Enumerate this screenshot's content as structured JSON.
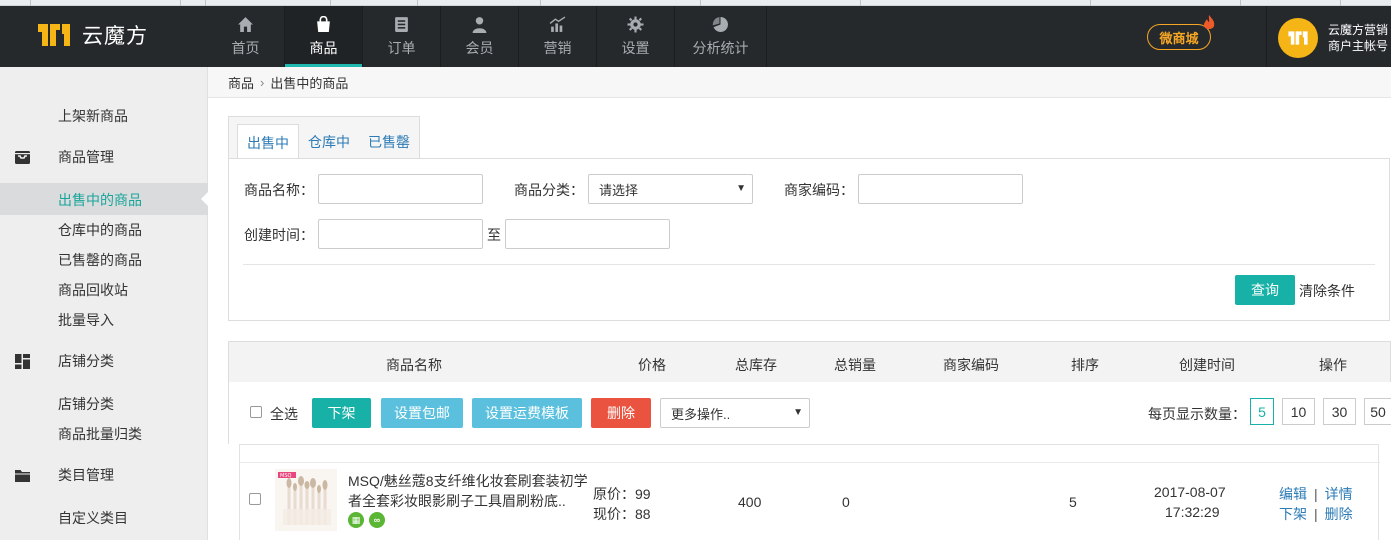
{
  "brand": {
    "name": "云魔方",
    "accent": "#1fb9b0",
    "logo_color": "#f6b516"
  },
  "nav": [
    {
      "label": "首页",
      "icon": "home-icon"
    },
    {
      "label": "商品",
      "icon": "shopping-bag-icon",
      "active": true
    },
    {
      "label": "订单",
      "icon": "order-list-icon"
    },
    {
      "label": "会员",
      "icon": "user-icon"
    },
    {
      "label": "营销",
      "icon": "marketing-chart-icon"
    },
    {
      "label": "设置",
      "icon": "gear-icon"
    },
    {
      "label": "分析统计",
      "icon": "pie-chart-icon"
    }
  ],
  "header": {
    "mall_badge": "微商城",
    "user_name": "云魔方营销",
    "user_role": "商户主帐号"
  },
  "sidebar": {
    "top_link": "上架新商品",
    "groups": [
      {
        "title": "商品管理",
        "icon": "inbox-icon",
        "items": [
          "出售中的商品",
          "仓库中的商品",
          "已售罄的商品",
          "商品回收站",
          "批量导入"
        ]
      },
      {
        "title": "店铺分类",
        "icon": "grid-icon",
        "items": [
          "店铺分类",
          "商品批量归类"
        ]
      },
      {
        "title": "类目管理",
        "icon": "folder-icon",
        "items": [
          "自定义类目"
        ]
      }
    ],
    "active_item": "出售中的商品"
  },
  "breadcrumb": {
    "root": "商品",
    "current": "出售中的商品"
  },
  "tabs": [
    "出售中",
    "仓库中",
    "已售罄"
  ],
  "filter": {
    "name_label": "商品名称：",
    "category_label": "商品分类：",
    "category_value": "请选择",
    "code_label": "商家编码：",
    "created_label": "创建时间：",
    "to_label": "至",
    "query_button": "查询",
    "clear_link": "清除条件"
  },
  "table": {
    "columns": [
      "商品名称",
      "价格",
      "总库存",
      "总销量",
      "商家编码",
      "排序",
      "创建时间",
      "操作"
    ]
  },
  "toolbar": {
    "select_all": "全选",
    "btn_off_shelf": "下架",
    "btn_free_shipping": "设置包邮",
    "btn_freight": "设置运费模板",
    "btn_delete": "删除",
    "more_ops": "更多操作..",
    "page_size_label": "每页显示数量：",
    "page_sizes": [
      "5",
      "10",
      "30",
      "50"
    ],
    "page_size_active": "5"
  },
  "rows": [
    {
      "thumb_brand": "MSQ",
      "title": "MSQ/魅丝蔻8支纤维化妆套刷套装初学者全套彩妆眼影刷子工具眉刷粉底..",
      "badge_icons": [
        "qr-code-icon",
        "link-icon"
      ],
      "original_price": "原价：99",
      "current_price": "现价：88",
      "stock": "400",
      "sales": "0",
      "merchant_code": "",
      "sort": "5",
      "created_date": "2017-08-07",
      "created_time": "17:32:29",
      "ops": [
        "编辑",
        "详情",
        "下架",
        "删除"
      ]
    }
  ]
}
